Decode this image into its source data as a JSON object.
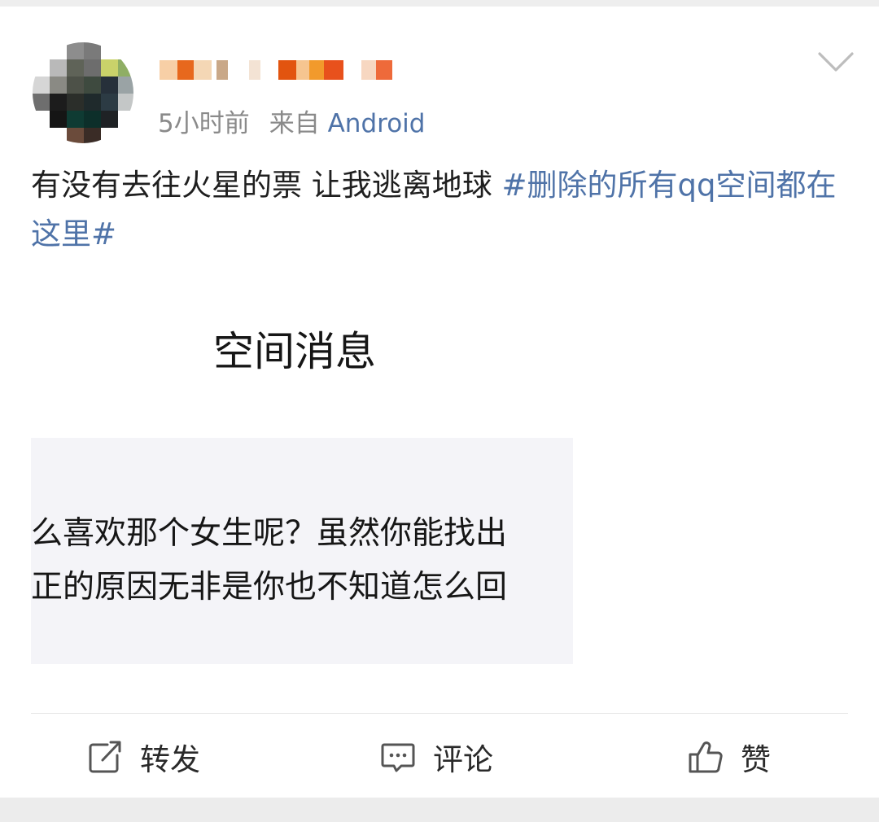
{
  "post": {
    "time": "5小时前",
    "from_label": "来自",
    "source": "Android",
    "text": "有没有去往火星的票 让我逃离地球 ",
    "topic": "#删除的所有qq空间都在这里#"
  },
  "embedded_image": {
    "title": "空间消息",
    "line1": "么喜欢那个女生呢？虽然你能找出",
    "line2": "正的原因无非是你也不知道怎么回"
  },
  "actions": {
    "repost": "转发",
    "comment": "评论",
    "like": "赞"
  },
  "icons": {
    "chevron": "chevron-down-icon",
    "repost": "repost-icon",
    "comment": "comment-icon",
    "like": "thumbs-up-icon"
  },
  "colors": {
    "link": "#4f73a8",
    "meta": "#8a8a8a"
  }
}
